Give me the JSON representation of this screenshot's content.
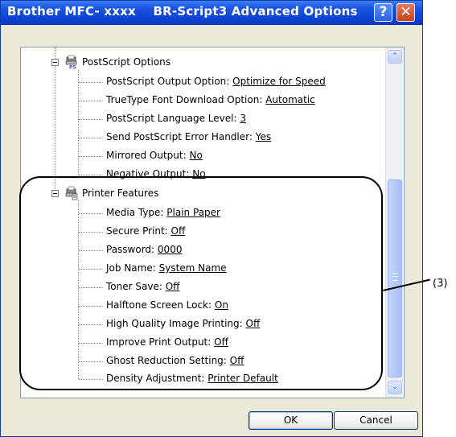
{
  "window": {
    "title": "Brother MFC- xxxx    BR-Script3 Advanced Options",
    "help_glyph": "?",
    "close_glyph": "✕"
  },
  "tree": {
    "postscript_group": {
      "label": "PostScript Options",
      "icon": "printer-ps-icon",
      "items": [
        {
          "label": "PostScript Output Option:",
          "value": "Optimize for Speed"
        },
        {
          "label": "TrueType Font Download Option:",
          "value": "Automatic"
        },
        {
          "label": "PostScript Language Level:",
          "value": "3"
        },
        {
          "label": "Send PostScript Error Handler:",
          "value": "Yes"
        },
        {
          "label": "Mirrored Output:",
          "value": "No"
        },
        {
          "label": "Negative Output:",
          "value": "No"
        }
      ]
    },
    "printer_group": {
      "label": "Printer Features",
      "icon": "printer-features-icon",
      "items": [
        {
          "label": "Media Type:",
          "value": "Plain Paper"
        },
        {
          "label": "Secure Print:",
          "value": "Off"
        },
        {
          "label": "Password:",
          "value": "0000"
        },
        {
          "label": "Job Name:",
          "value": "System Name"
        },
        {
          "label": "Toner Save:",
          "value": "Off"
        },
        {
          "label": "Halftone Screen Lock:",
          "value": "On"
        },
        {
          "label": "High Quality Image Printing:",
          "value": "Off"
        },
        {
          "label": "Improve Print Output:",
          "value": "Off"
        },
        {
          "label": "Ghost Reduction Setting:",
          "value": "Off"
        },
        {
          "label": "Density Adjustment:",
          "value": "Printer Default"
        }
      ]
    }
  },
  "scroll": {
    "up_glyph": "⌃",
    "down_glyph": "⌄"
  },
  "annotation": {
    "label": "(3)"
  },
  "buttons": {
    "ok": "OK",
    "cancel": "Cancel"
  }
}
